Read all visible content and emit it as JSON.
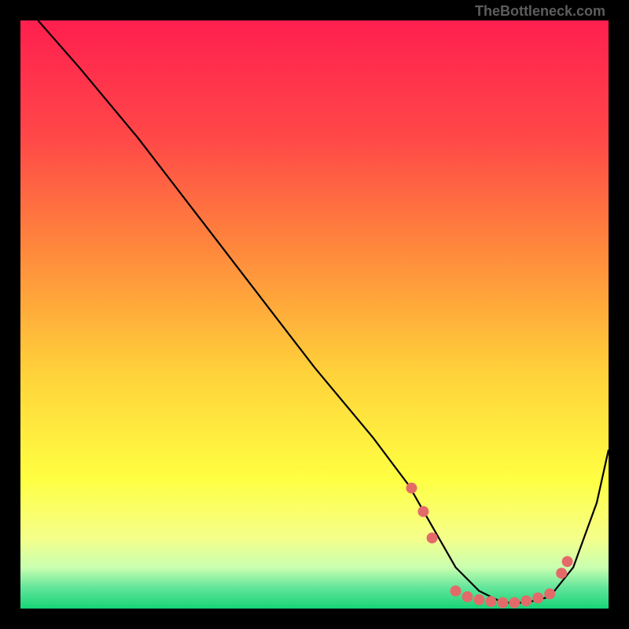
{
  "watermark": "TheBottleneck.com",
  "chart_data": {
    "type": "line",
    "title": "",
    "xlabel": "",
    "ylabel": "",
    "xlim": [
      0,
      100
    ],
    "ylim": [
      0,
      100
    ],
    "background": {
      "style": "vertical-gradient",
      "stops": [
        {
          "pos": 0.0,
          "color": "#ff1f4f"
        },
        {
          "pos": 0.2,
          "color": "#ff4848"
        },
        {
          "pos": 0.4,
          "color": "#ff8c3c"
        },
        {
          "pos": 0.6,
          "color": "#ffd23a"
        },
        {
          "pos": 0.78,
          "color": "#ffff42"
        },
        {
          "pos": 0.88,
          "color": "#f5ff8a"
        },
        {
          "pos": 0.93,
          "color": "#c9ffb0"
        },
        {
          "pos": 0.965,
          "color": "#61e59a"
        },
        {
          "pos": 1.0,
          "color": "#17d477"
        }
      ]
    },
    "series": [
      {
        "name": "bottleneck-curve",
        "color": "#000000",
        "x": [
          3,
          10,
          20,
          30,
          40,
          50,
          60,
          66,
          70,
          74,
          78,
          82,
          86,
          90,
          94,
          98,
          100
        ],
        "y": [
          100,
          92,
          80,
          67,
          54,
          41,
          29,
          21,
          14,
          7,
          3,
          1,
          1,
          2,
          7,
          18,
          27
        ]
      }
    ],
    "markers": {
      "name": "highlighted-points",
      "color": "#e46a6a",
      "points": [
        {
          "x": 66.5,
          "y": 20.5
        },
        {
          "x": 68.5,
          "y": 16.5
        },
        {
          "x": 70.0,
          "y": 12.0
        },
        {
          "x": 74.0,
          "y": 3.0
        },
        {
          "x": 76.0,
          "y": 2.0
        },
        {
          "x": 78.0,
          "y": 1.5
        },
        {
          "x": 80.0,
          "y": 1.2
        },
        {
          "x": 82.0,
          "y": 1.0
        },
        {
          "x": 84.0,
          "y": 1.0
        },
        {
          "x": 86.0,
          "y": 1.3
        },
        {
          "x": 88.0,
          "y": 1.8
        },
        {
          "x": 90.0,
          "y": 2.5
        },
        {
          "x": 92.0,
          "y": 6.0
        },
        {
          "x": 93.0,
          "y": 8.0
        }
      ]
    }
  }
}
